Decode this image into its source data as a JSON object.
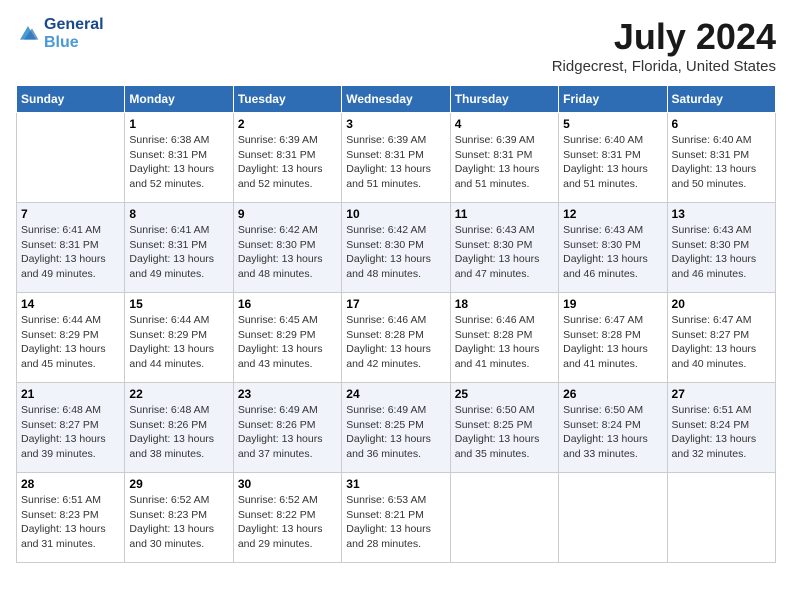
{
  "logo": {
    "line1": "General",
    "line2": "Blue"
  },
  "title": "July 2024",
  "location": "Ridgecrest, Florida, United States",
  "weekdays": [
    "Sunday",
    "Monday",
    "Tuesday",
    "Wednesday",
    "Thursday",
    "Friday",
    "Saturday"
  ],
  "weeks": [
    [
      {
        "day": "",
        "sunrise": "",
        "sunset": "",
        "daylight": ""
      },
      {
        "day": "1",
        "sunrise": "Sunrise: 6:38 AM",
        "sunset": "Sunset: 8:31 PM",
        "daylight": "Daylight: 13 hours and 52 minutes."
      },
      {
        "day": "2",
        "sunrise": "Sunrise: 6:39 AM",
        "sunset": "Sunset: 8:31 PM",
        "daylight": "Daylight: 13 hours and 52 minutes."
      },
      {
        "day": "3",
        "sunrise": "Sunrise: 6:39 AM",
        "sunset": "Sunset: 8:31 PM",
        "daylight": "Daylight: 13 hours and 51 minutes."
      },
      {
        "day": "4",
        "sunrise": "Sunrise: 6:39 AM",
        "sunset": "Sunset: 8:31 PM",
        "daylight": "Daylight: 13 hours and 51 minutes."
      },
      {
        "day": "5",
        "sunrise": "Sunrise: 6:40 AM",
        "sunset": "Sunset: 8:31 PM",
        "daylight": "Daylight: 13 hours and 51 minutes."
      },
      {
        "day": "6",
        "sunrise": "Sunrise: 6:40 AM",
        "sunset": "Sunset: 8:31 PM",
        "daylight": "Daylight: 13 hours and 50 minutes."
      }
    ],
    [
      {
        "day": "7",
        "sunrise": "Sunrise: 6:41 AM",
        "sunset": "Sunset: 8:31 PM",
        "daylight": "Daylight: 13 hours and 49 minutes."
      },
      {
        "day": "8",
        "sunrise": "Sunrise: 6:41 AM",
        "sunset": "Sunset: 8:31 PM",
        "daylight": "Daylight: 13 hours and 49 minutes."
      },
      {
        "day": "9",
        "sunrise": "Sunrise: 6:42 AM",
        "sunset": "Sunset: 8:30 PM",
        "daylight": "Daylight: 13 hours and 48 minutes."
      },
      {
        "day": "10",
        "sunrise": "Sunrise: 6:42 AM",
        "sunset": "Sunset: 8:30 PM",
        "daylight": "Daylight: 13 hours and 48 minutes."
      },
      {
        "day": "11",
        "sunrise": "Sunrise: 6:43 AM",
        "sunset": "Sunset: 8:30 PM",
        "daylight": "Daylight: 13 hours and 47 minutes."
      },
      {
        "day": "12",
        "sunrise": "Sunrise: 6:43 AM",
        "sunset": "Sunset: 8:30 PM",
        "daylight": "Daylight: 13 hours and 46 minutes."
      },
      {
        "day": "13",
        "sunrise": "Sunrise: 6:43 AM",
        "sunset": "Sunset: 8:30 PM",
        "daylight": "Daylight: 13 hours and 46 minutes."
      }
    ],
    [
      {
        "day": "14",
        "sunrise": "Sunrise: 6:44 AM",
        "sunset": "Sunset: 8:29 PM",
        "daylight": "Daylight: 13 hours and 45 minutes."
      },
      {
        "day": "15",
        "sunrise": "Sunrise: 6:44 AM",
        "sunset": "Sunset: 8:29 PM",
        "daylight": "Daylight: 13 hours and 44 minutes."
      },
      {
        "day": "16",
        "sunrise": "Sunrise: 6:45 AM",
        "sunset": "Sunset: 8:29 PM",
        "daylight": "Daylight: 13 hours and 43 minutes."
      },
      {
        "day": "17",
        "sunrise": "Sunrise: 6:46 AM",
        "sunset": "Sunset: 8:28 PM",
        "daylight": "Daylight: 13 hours and 42 minutes."
      },
      {
        "day": "18",
        "sunrise": "Sunrise: 6:46 AM",
        "sunset": "Sunset: 8:28 PM",
        "daylight": "Daylight: 13 hours and 41 minutes."
      },
      {
        "day": "19",
        "sunrise": "Sunrise: 6:47 AM",
        "sunset": "Sunset: 8:28 PM",
        "daylight": "Daylight: 13 hours and 41 minutes."
      },
      {
        "day": "20",
        "sunrise": "Sunrise: 6:47 AM",
        "sunset": "Sunset: 8:27 PM",
        "daylight": "Daylight: 13 hours and 40 minutes."
      }
    ],
    [
      {
        "day": "21",
        "sunrise": "Sunrise: 6:48 AM",
        "sunset": "Sunset: 8:27 PM",
        "daylight": "Daylight: 13 hours and 39 minutes."
      },
      {
        "day": "22",
        "sunrise": "Sunrise: 6:48 AM",
        "sunset": "Sunset: 8:26 PM",
        "daylight": "Daylight: 13 hours and 38 minutes."
      },
      {
        "day": "23",
        "sunrise": "Sunrise: 6:49 AM",
        "sunset": "Sunset: 8:26 PM",
        "daylight": "Daylight: 13 hours and 37 minutes."
      },
      {
        "day": "24",
        "sunrise": "Sunrise: 6:49 AM",
        "sunset": "Sunset: 8:25 PM",
        "daylight": "Daylight: 13 hours and 36 minutes."
      },
      {
        "day": "25",
        "sunrise": "Sunrise: 6:50 AM",
        "sunset": "Sunset: 8:25 PM",
        "daylight": "Daylight: 13 hours and 35 minutes."
      },
      {
        "day": "26",
        "sunrise": "Sunrise: 6:50 AM",
        "sunset": "Sunset: 8:24 PM",
        "daylight": "Daylight: 13 hours and 33 minutes."
      },
      {
        "day": "27",
        "sunrise": "Sunrise: 6:51 AM",
        "sunset": "Sunset: 8:24 PM",
        "daylight": "Daylight: 13 hours and 32 minutes."
      }
    ],
    [
      {
        "day": "28",
        "sunrise": "Sunrise: 6:51 AM",
        "sunset": "Sunset: 8:23 PM",
        "daylight": "Daylight: 13 hours and 31 minutes."
      },
      {
        "day": "29",
        "sunrise": "Sunrise: 6:52 AM",
        "sunset": "Sunset: 8:23 PM",
        "daylight": "Daylight: 13 hours and 30 minutes."
      },
      {
        "day": "30",
        "sunrise": "Sunrise: 6:52 AM",
        "sunset": "Sunset: 8:22 PM",
        "daylight": "Daylight: 13 hours and 29 minutes."
      },
      {
        "day": "31",
        "sunrise": "Sunrise: 6:53 AM",
        "sunset": "Sunset: 8:21 PM",
        "daylight": "Daylight: 13 hours and 28 minutes."
      },
      {
        "day": "",
        "sunrise": "",
        "sunset": "",
        "daylight": ""
      },
      {
        "day": "",
        "sunrise": "",
        "sunset": "",
        "daylight": ""
      },
      {
        "day": "",
        "sunrise": "",
        "sunset": "",
        "daylight": ""
      }
    ]
  ]
}
